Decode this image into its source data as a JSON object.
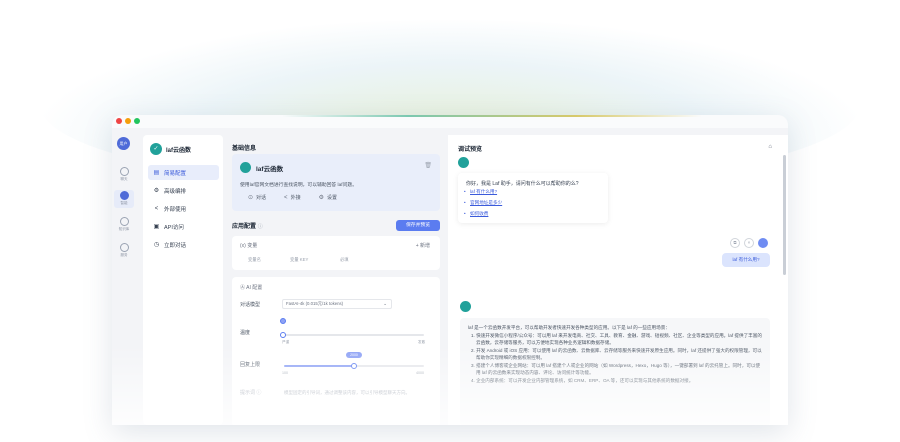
{
  "rail": {
    "avatar_text": "用户",
    "items": [
      {
        "label": "聊天",
        "icon": "chat-icon"
      },
      {
        "label": "智能",
        "icon": "agent-icon",
        "active": true
      },
      {
        "label": "知识库",
        "icon": "database-icon"
      },
      {
        "label": "服务",
        "icon": "service-icon"
      }
    ]
  },
  "nav": {
    "app_name": "laf云函数",
    "items": [
      {
        "icon": "▤",
        "label": "简易配置",
        "active": true
      },
      {
        "icon": "⚙",
        "label": "高级编排"
      },
      {
        "icon": "<",
        "label": "外部使用"
      },
      {
        "icon": "▣",
        "label": "API访问"
      },
      {
        "icon": "◷",
        "label": "立即对话"
      }
    ]
  },
  "config": {
    "basic_title": "基础信息",
    "bot_name": "laf云函数",
    "bot_desc": "使用laf官网文档进行查找说明，可以辅助回答 laf问题。",
    "actions": [
      {
        "icon": "⊙",
        "label": "对话"
      },
      {
        "icon": "<",
        "label": "外接"
      },
      {
        "icon": "⚙",
        "label": "设置"
      }
    ],
    "app_config_title": "应用配置",
    "help_glyph": "ⓘ",
    "save_label": "保存并预览",
    "vars_title": "(x)  变量",
    "vars_add": "+ 新增",
    "vars_headers": [
      "变量名",
      "变量 KEY",
      "必填"
    ],
    "ai_title": "Ⓐ  AI 配置",
    "model_label": "对话模型",
    "model_value": "FastAI-4k (0.015元/1k tokens)",
    "temperature_label": "温度",
    "temp_min": "严谨",
    "temp_max": "发散",
    "reply_limit_label": "回复上限",
    "reply_limit_value": "2000",
    "reply_min": "100",
    "reply_max": "4000",
    "prompt_label": "提示词 ⓘ",
    "prompt_placeholder": "模型固定的引导词，通过调整该内容，可以引导模型聊天方向。"
  },
  "preview": {
    "title": "调试预览",
    "greeting": "你好，我是 Laf 助手，请问有什么可以帮助你的么?",
    "suggestions": [
      "laf 有什么用?",
      "官网地址是多少",
      "如何收费"
    ],
    "user_message": "laf 有什么用?",
    "answer_intro": "laf 是一个云函数开发平台，可以帮助开发者快速开发各种类型的应用。以下是 laf 的一些应用场景：",
    "answer_items": [
      "1. 快速开发微信小程序/公众号：可以用 laf 来开发电商、社交、工具、教育、金融、游戏、短视频、社区、企业等类型的应用。laf 提供了丰富的云函数，云存储等服务，可以方便地实现各种业务逻辑和数据存储。",
      "2. 开发 Android 或 iOS 应用：可以使用 laf 的云函数、云数据库、云存储等服务来快速开发原生应用。同时，laf 还提供了强大的权限管理，可以帮助你实现精细的数据权限控制。",
      "3. 搭建个人博客或企业网站：可以用 laf 搭建个人或企业的网站（如 Wordpress，Hexo，Hugo 等），一键部署到 laf 的云托管上。同时，可以使用 laf 的云函数来实现动态内容、评论、访问统计等功能。",
      "4. 企业内部系统：可以开发企业内部管理系统，如 CRM、ERP、OA 等，还可以实现与其他系统的数据对接。"
    ]
  },
  "colors": {
    "accent": "#5b7cf0",
    "brand": "#21a19a",
    "active_bg": "#e8edfb"
  }
}
